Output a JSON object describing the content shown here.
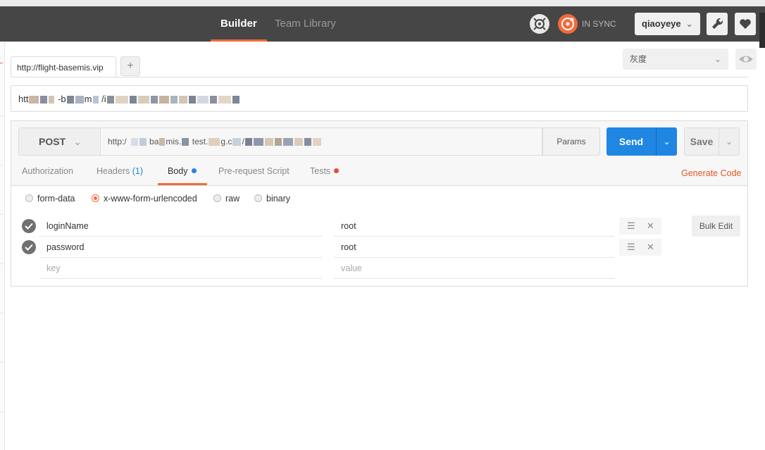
{
  "header": {
    "tabs": [
      {
        "label": "Builder",
        "active": true
      },
      {
        "label": "Team Library",
        "active": false
      }
    ],
    "sync_status": "IN SYNC",
    "user": "qiaoyeye",
    "colors": {
      "bar": "#464646",
      "accent": "#f26b3a"
    }
  },
  "request_tab": {
    "label": "http://flight-basemis.vip",
    "add_label": "+"
  },
  "environment": {
    "selected": "灰度",
    "chevron": "⌄"
  },
  "request_name": {
    "prefix": "htt",
    "visible_fragments": [
      "-b",
      "m",
      "/i"
    ]
  },
  "request": {
    "method": "POST",
    "url_fragments": [
      "http:/",
      "ba",
      "mis.",
      "test.",
      "g.c",
      "/"
    ],
    "params_label": "Params",
    "send_label": "Send",
    "save_label": "Save"
  },
  "subtabs": [
    {
      "label": "Authorization"
    },
    {
      "label": "Headers",
      "count": "(1)"
    },
    {
      "label": "Body",
      "dot_color": "#1f86e2",
      "active": true
    },
    {
      "label": "Pre-request Script"
    },
    {
      "label": "Tests",
      "dot_color": "#e74c3c"
    }
  ],
  "generate_code_label": "Generate Code",
  "body_modes": [
    {
      "label": "form-data",
      "selected": false
    },
    {
      "label": "x-www-form-urlencoded",
      "selected": true
    },
    {
      "label": "raw",
      "selected": false
    },
    {
      "label": "binary",
      "selected": false
    }
  ],
  "params": [
    {
      "key": "loginName",
      "value": "root",
      "enabled": true
    },
    {
      "key": "password",
      "value": "root",
      "enabled": true
    }
  ],
  "placeholder_row": {
    "key": "key",
    "value": "value"
  },
  "bulk_edit_label": "Bulk Edit",
  "row_icons": {
    "menu": "☰",
    "remove": "✕"
  }
}
